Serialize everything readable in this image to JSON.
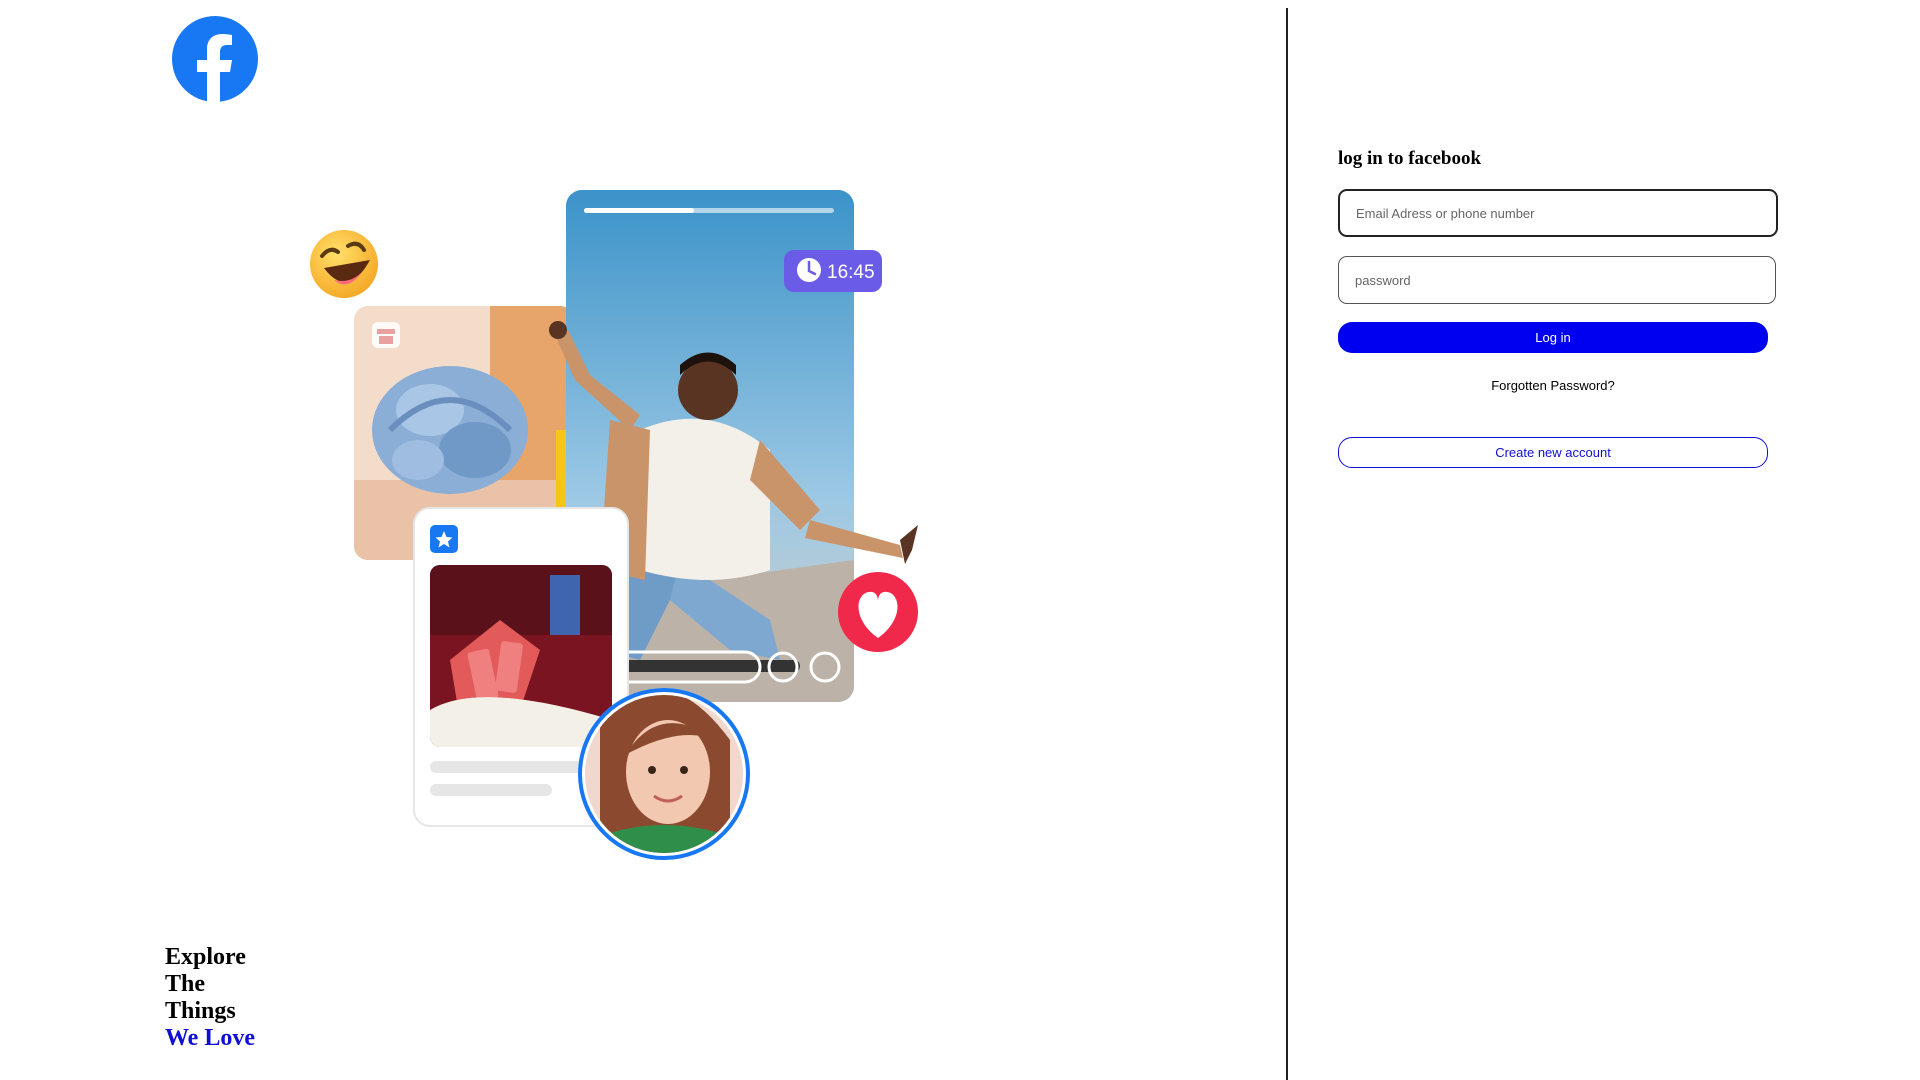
{
  "brand": {
    "logo_icon": "facebook-logo-icon",
    "color": "#1877f2"
  },
  "hero": {
    "time_badge": "16:45",
    "icons": [
      "laughing-emoji-icon",
      "shop-icon",
      "bookmark-star-icon",
      "heart-icon",
      "clock-icon"
    ]
  },
  "tagline": {
    "line1": "Explore",
    "line2": "The",
    "line3": "Things",
    "line4": "We Love"
  },
  "login": {
    "title": "log in to facebook",
    "email_placeholder": "Email Adress or phone number",
    "password_placeholder": "password",
    "login_label": "Log in",
    "forgot_label": "Forgotten Password?",
    "create_label": "Create new account",
    "accent_color": "#0000f0"
  }
}
